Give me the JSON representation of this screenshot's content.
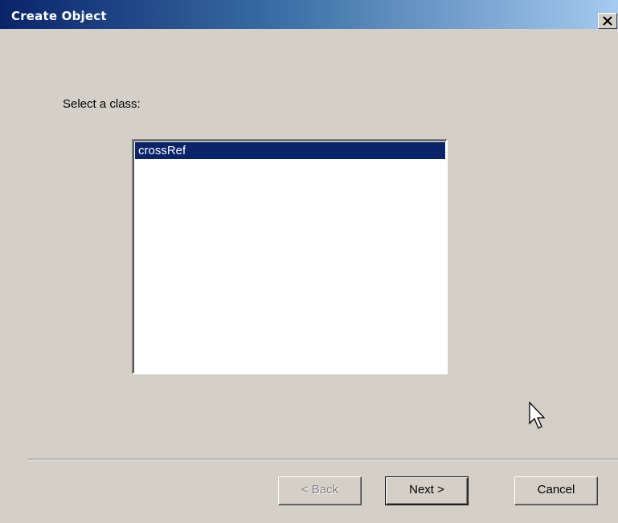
{
  "window": {
    "title": "Create Object",
    "close_glyph": "✕"
  },
  "content": {
    "prompt": "Select a class:",
    "class_list": {
      "items": [
        "crossRef"
      ],
      "selected_index": 0
    }
  },
  "buttons": {
    "back_label": "< Back",
    "next_label": "Next >",
    "cancel_label": "Cancel"
  },
  "colors": {
    "title_bar_start": "#0a246a",
    "title_bar_end": "#a6caf0",
    "selection": "#0a246a",
    "dialog_face": "#d4d0c8"
  }
}
